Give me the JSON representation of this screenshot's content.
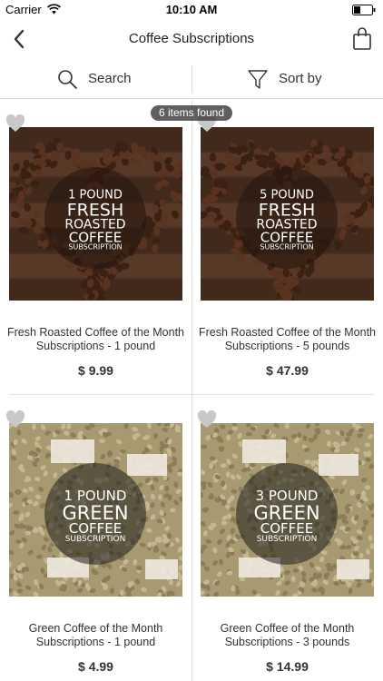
{
  "status_bar": {
    "carrier": "Carrier",
    "time": "10:10 AM"
  },
  "nav": {
    "title": "Coffee Subscriptions",
    "back_icon": "chevron-left-icon",
    "bag_icon": "shopping-bag-icon"
  },
  "filter_bar": {
    "search_label": "Search",
    "sort_label": "Sort by"
  },
  "results": {
    "count_label": "6 items found"
  },
  "colors": {
    "wood_dark": "#4a2f20",
    "bean_brown": "#5a3320",
    "green_bag": "#a89a70",
    "heart_gray": "#c8c8c8"
  },
  "products": [
    {
      "name": "Fresh Roasted Coffee of the Month Subscriptions - 1 pound",
      "price": "$ 9.99",
      "image_lines": [
        "1 POUND",
        "FRESH",
        "ROASTED",
        "COFFEE",
        "SUBSCRIPTION"
      ],
      "image_type": "roasted",
      "favorited": false
    },
    {
      "name": "Fresh Roasted Coffee of the Month Subscriptions - 5 pounds",
      "price": "$ 47.99",
      "image_lines": [
        "5 POUND",
        "FRESH",
        "ROASTED",
        "COFFEE",
        "SUBSCRIPTION"
      ],
      "image_type": "roasted",
      "favorited": false
    },
    {
      "name": "Green Coffee of the Month Subscriptions - 1 pound",
      "price": "$ 4.99",
      "image_lines": [
        "1 POUND",
        "GREEN",
        "COFFEE",
        "SUBSCRIPTION"
      ],
      "image_type": "green",
      "favorited": false
    },
    {
      "name": "Green Coffee of the Month Subscriptions - 3 pounds",
      "price": "$ 14.99",
      "image_lines": [
        "3 POUND",
        "GREEN",
        "COFFEE",
        "SUBSCRIPTION"
      ],
      "image_type": "green",
      "favorited": false
    }
  ]
}
